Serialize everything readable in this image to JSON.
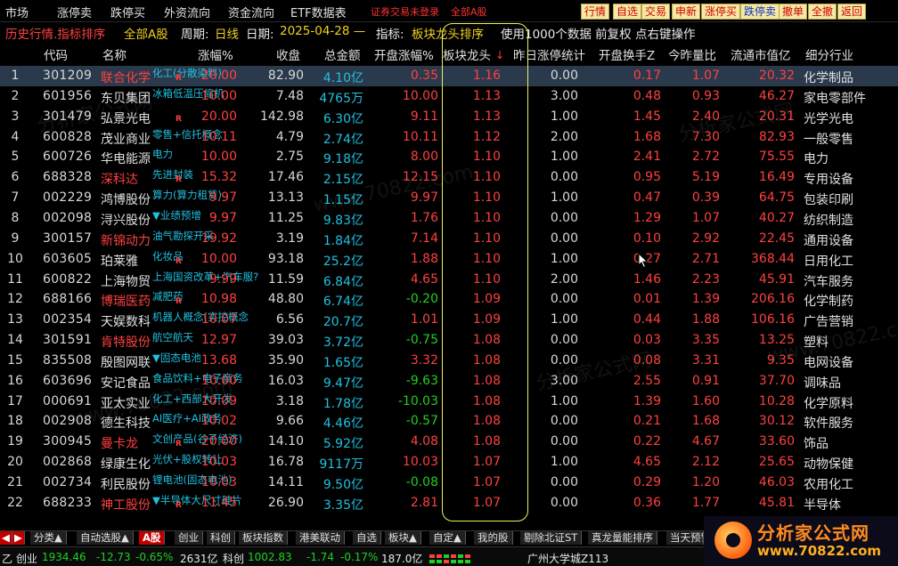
{
  "menubar": {
    "items": [
      "市场",
      "涨停卖",
      "跌停买",
      "外资流向",
      "资金流向",
      "ETF数据表"
    ],
    "promo": [
      "证券交易未登录",
      "全部A股"
    ],
    "toolbar_buttons": [
      "行情",
      "自选",
      "交易",
      "申新",
      "涨停买",
      "跌停卖",
      "撤单",
      "全撤",
      "返回"
    ]
  },
  "infobar": {
    "mode": "历史行情.指标排序",
    "market": "全部A股",
    "period_label": "周期:",
    "period_value": "日线",
    "date_label": "日期:",
    "date_value": "2025-04-28 —",
    "indicator_label": "指标:",
    "indicator_value": "板块龙头排序",
    "tail": "使用1000个数据 前复权 点右键操作"
  },
  "table": {
    "columns": [
      "代码",
      "名称",
      "涨幅%",
      "收盘",
      "总金额",
      "开盘涨幅%",
      "板块龙头",
      "昨日涨停统计",
      "开盘换手Z",
      "今昨量比",
      "流通市值亿",
      "细分行业"
    ],
    "sort_arrow": "↓",
    "rows": [
      {
        "n": "1",
        "code": "301209",
        "name": "联合化学",
        "tag": "化工(分散染料)",
        "r": "R",
        "red": true,
        "pct": "20.00",
        "price": "82.90",
        "amt": "4.10亿",
        "open": "0.35",
        "blk": "1.16",
        "yest": "0.00",
        "turn": "0.17",
        "vr": "1.07",
        "cap": "20.32",
        "ind": "化学制品",
        "open_dir": "up"
      },
      {
        "n": "2",
        "code": "601956",
        "name": "东贝集团",
        "tag": "冰箱低温压缩机",
        "r": "",
        "red": false,
        "pct": "10.00",
        "price": "7.48",
        "amt": "4765万",
        "open": "10.00",
        "blk": "1.13",
        "yest": "3.00",
        "turn": "0.48",
        "vr": "0.93",
        "cap": "46.27",
        "ind": "家电零部件",
        "open_dir": "up"
      },
      {
        "n": "3",
        "code": "301479",
        "name": "弘景光电",
        "tag": "",
        "r": "R",
        "red": false,
        "pct": "20.00",
        "price": "142.98",
        "amt": "6.30亿",
        "open": "9.11",
        "blk": "1.13",
        "yest": "1.00",
        "turn": "1.45",
        "vr": "2.40",
        "cap": "20.31",
        "ind": "光学光电",
        "open_dir": "up"
      },
      {
        "n": "4",
        "code": "600828",
        "name": "茂业商业",
        "tag": "零售+信托概念",
        "r": "",
        "red": false,
        "pct": "10.11",
        "price": "4.79",
        "amt": "2.74亿",
        "open": "10.11",
        "blk": "1.12",
        "yest": "2.00",
        "turn": "1.68",
        "vr": "7.30",
        "cap": "82.93",
        "ind": "一般零售",
        "open_dir": "up"
      },
      {
        "n": "5",
        "code": "600726",
        "name": "华电能源",
        "tag": "电力",
        "r": "",
        "red": false,
        "pct": "10.00",
        "price": "2.75",
        "amt": "9.18亿",
        "open": "8.00",
        "blk": "1.10",
        "yest": "1.00",
        "turn": "2.41",
        "vr": "2.72",
        "cap": "75.55",
        "ind": "电力",
        "open_dir": "up"
      },
      {
        "n": "6",
        "code": "688328",
        "name": "深科达",
        "tag": "先进封装",
        "r": "R",
        "red": true,
        "pct": "15.32",
        "price": "17.46",
        "amt": "2.15亿",
        "open": "12.15",
        "blk": "1.10",
        "yest": "0.00",
        "turn": "0.95",
        "vr": "5.19",
        "cap": "16.49",
        "ind": "专用设备",
        "open_dir": "up"
      },
      {
        "n": "7",
        "code": "002229",
        "name": "鸿博股份",
        "tag": "算力(算力租赁)",
        "r": "",
        "red": false,
        "pct": "9.97",
        "price": "13.13",
        "amt": "1.15亿",
        "open": "9.97",
        "blk": "1.10",
        "yest": "1.00",
        "turn": "0.47",
        "vr": "0.39",
        "cap": "64.75",
        "ind": "包装印刷",
        "open_dir": "up"
      },
      {
        "n": "8",
        "code": "002098",
        "name": "浔兴股份",
        "tag": "▼业绩预增",
        "r": "",
        "red": false,
        "pct": "9.97",
        "price": "11.25",
        "amt": "9.83亿",
        "open": "1.76",
        "blk": "1.10",
        "yest": "0.00",
        "turn": "1.29",
        "vr": "1.07",
        "cap": "40.27",
        "ind": "纺织制造",
        "open_dir": "up"
      },
      {
        "n": "9",
        "code": "300157",
        "name": "新锦动力",
        "tag": "油气勘探开采",
        "r": "",
        "red": true,
        "pct": "19.92",
        "price": "3.19",
        "amt": "1.84亿",
        "open": "7.14",
        "blk": "1.10",
        "yest": "0.00",
        "turn": "0.10",
        "vr": "2.92",
        "cap": "22.45",
        "ind": "通用设备",
        "open_dir": "up"
      },
      {
        "n": "10",
        "code": "603605",
        "name": "珀莱雅",
        "tag": "化妆品",
        "r": "R",
        "red": false,
        "pct": "10.00",
        "price": "93.18",
        "amt": "25.2亿",
        "open": "1.88",
        "blk": "1.10",
        "yest": "1.00",
        "turn": "0.27",
        "vr": "2.71",
        "cap": "368.44",
        "ind": "日用化工",
        "open_dir": "up"
      },
      {
        "n": "11",
        "code": "600822",
        "name": "上海物贸",
        "tag": "上海国资改革+汽车服?",
        "r": "",
        "red": false,
        "pct": "9.99",
        "price": "11.59",
        "amt": "6.84亿",
        "open": "4.65",
        "blk": "1.10",
        "yest": "2.00",
        "turn": "1.46",
        "vr": "2.23",
        "cap": "45.91",
        "ind": "汽车服务",
        "open_dir": "up"
      },
      {
        "n": "12",
        "code": "688166",
        "name": "博瑞医药",
        "tag": "减肥药",
        "r": "R",
        "red": true,
        "pct": "10.98",
        "price": "48.80",
        "amt": "6.74亿",
        "open": "-0.20",
        "blk": "1.09",
        "yest": "0.00",
        "turn": "0.01",
        "vr": "1.39",
        "cap": "206.16",
        "ind": "化学制药",
        "open_dir": "down"
      },
      {
        "n": "13",
        "code": "002354",
        "name": "天娱数科",
        "tag": "机器人概念(实控概念",
        "r": "",
        "red": false,
        "pct": "10.07",
        "price": "6.56",
        "amt": "20.7亿",
        "open": "1.01",
        "blk": "1.09",
        "yest": "1.00",
        "turn": "0.44",
        "vr": "1.88",
        "cap": "106.16",
        "ind": "广告营销",
        "open_dir": "up"
      },
      {
        "n": "14",
        "code": "301591",
        "name": "肯特股份",
        "tag": "航空航天",
        "r": "",
        "red": true,
        "pct": "12.97",
        "price": "39.03",
        "amt": "3.72亿",
        "open": "-0.75",
        "blk": "1.08",
        "yest": "0.00",
        "turn": "0.03",
        "vr": "3.35",
        "cap": "13.25",
        "ind": "塑料",
        "open_dir": "down"
      },
      {
        "n": "15",
        "code": "835508",
        "name": "殷图网联",
        "tag": "▼固态电池",
        "r": "",
        "red": false,
        "pct": "13.68",
        "price": "35.90",
        "amt": "1.65亿",
        "open": "3.32",
        "blk": "1.08",
        "yest": "0.00",
        "turn": "0.08",
        "vr": "3.31",
        "cap": "9.35",
        "ind": "电网设备",
        "open_dir": "up"
      },
      {
        "n": "16",
        "code": "603696",
        "name": "安记食品",
        "tag": "食品饮料+电子商务",
        "r": "",
        "red": false,
        "pct": "10.00",
        "price": "16.03",
        "amt": "9.47亿",
        "open": "-9.63",
        "blk": "1.08",
        "yest": "3.00",
        "turn": "2.55",
        "vr": "0.91",
        "cap": "37.70",
        "ind": "调味品",
        "open_dir": "down"
      },
      {
        "n": "17",
        "code": "000691",
        "name": "亚太实业",
        "tag": "化工+西部大开发",
        "r": "",
        "red": false,
        "pct": "10.09",
        "price": "3.18",
        "amt": "1.78亿",
        "open": "-10.03",
        "blk": "1.08",
        "yest": "1.00",
        "turn": "1.39",
        "vr": "1.60",
        "cap": "10.28",
        "ind": "化学原料",
        "open_dir": "down"
      },
      {
        "n": "18",
        "code": "002908",
        "name": "德生科技",
        "tag": "AI医疗+AI政务",
        "r": "",
        "red": false,
        "pct": "10.02",
        "price": "9.66",
        "amt": "4.46亿",
        "open": "-0.57",
        "blk": "1.08",
        "yest": "0.00",
        "turn": "0.21",
        "vr": "1.68",
        "cap": "30.12",
        "ind": "软件服务",
        "open_dir": "down"
      },
      {
        "n": "19",
        "code": "300945",
        "name": "曼卡龙",
        "tag": "文创产品(谷子经济)",
        "r": "R",
        "red": true,
        "pct": "20.00",
        "price": "14.10",
        "amt": "5.92亿",
        "open": "4.08",
        "blk": "1.08",
        "yest": "0.00",
        "turn": "0.22",
        "vr": "4.67",
        "cap": "33.60",
        "ind": "饰品",
        "open_dir": "up"
      },
      {
        "n": "20",
        "code": "002868",
        "name": "绿康生化",
        "tag": "光伏+股权转让",
        "r": "",
        "red": false,
        "pct": "10.03",
        "price": "16.78",
        "amt": "9117万",
        "open": "10.03",
        "blk": "1.07",
        "yest": "1.00",
        "turn": "4.65",
        "vr": "2.12",
        "cap": "25.65",
        "ind": "动物保健",
        "open_dir": "up"
      },
      {
        "n": "21",
        "code": "002734",
        "name": "利民股份",
        "tag": "锂电池(固态电池)",
        "r": "",
        "red": false,
        "pct": "10.03",
        "price": "14.11",
        "amt": "9.50亿",
        "open": "-0.08",
        "blk": "1.07",
        "yest": "0.00",
        "turn": "0.29",
        "vr": "1.20",
        "cap": "46.03",
        "ind": "农用化工",
        "open_dir": "down"
      },
      {
        "n": "22",
        "code": "688233",
        "name": "神工股份",
        "tag": "▼半导体大尺寸硅片",
        "r": "R",
        "red": true,
        "pct": "11.45",
        "price": "26.90",
        "amt": "3.35亿",
        "open": "2.81",
        "blk": "1.07",
        "yest": "0.00",
        "turn": "0.36",
        "vr": "1.77",
        "cap": "45.81",
        "ind": "半导体",
        "open_dir": "up"
      }
    ]
  },
  "tabs": [
    "分类▲",
    "自动选股▲",
    "A股",
    "创业",
    "科创",
    "板块指数",
    "港美联动",
    "自选",
    "板块▲",
    "自定▲",
    "我的股",
    "剔除北证ST",
    "真龙量能排序",
    "当天预警"
  ],
  "statusbar": {
    "cy_label": "创业",
    "cy_index": "1934.46",
    "cy_change": "-12.73",
    "cy_pct": "-0.65%",
    "cy_amount": "2631亿",
    "kc_label": "科创",
    "kc_index": "1002.83",
    "kc_change": "-1.74",
    "kc_pct": "-0.17%",
    "kc_amount": "187.0亿",
    "server": "广州大学城Z113",
    "left_char": "乙"
  },
  "logo": {
    "cn": "分析家公式网",
    "url": "www.70822.com"
  },
  "watermarks": [
    "分析家公式网",
    "www.70822.com"
  ],
  "colors": {
    "up": "#ff4040",
    "down": "#20d020",
    "accent": "#f0d020",
    "highlight": "#f0f060",
    "tag": "#20c0e0"
  }
}
